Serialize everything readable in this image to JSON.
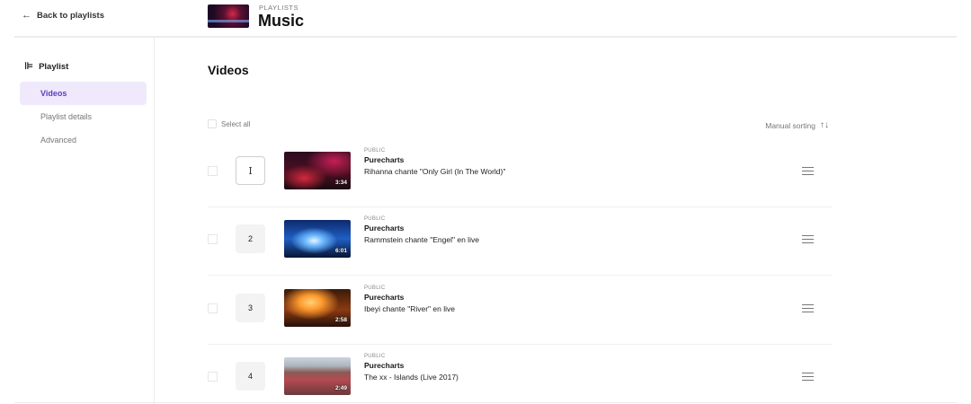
{
  "header": {
    "back_label": "Back to playlists",
    "kicker": "PLAYLISTS",
    "title": "Music"
  },
  "sidebar": {
    "heading": "Playlist",
    "items": [
      {
        "label": "Videos",
        "active": true
      },
      {
        "label": "Playlist details",
        "active": false
      },
      {
        "label": "Advanced",
        "active": false
      }
    ]
  },
  "main": {
    "section_title": "Videos",
    "select_all_label": "Select all",
    "sorting_label": "Manual sorting",
    "videos": [
      {
        "order": "",
        "visibility": "PUBLIC",
        "channel": "Purecharts",
        "title": "Rihanna chante \"Only Girl (In The World)\"",
        "duration": "3:34"
      },
      {
        "order": "2",
        "visibility": "PUBLIC",
        "channel": "Purecharts",
        "title": "Rammstein chante \"Engel\" en live",
        "duration": "6:01"
      },
      {
        "order": "3",
        "visibility": "PUBLIC",
        "channel": "Purecharts",
        "title": "Ibeyi chante \"River\" en live",
        "duration": "2:58"
      },
      {
        "order": "4",
        "visibility": "PUBLIC",
        "channel": "Purecharts",
        "title": "The xx - Islands (Live 2017)",
        "duration": "2:49"
      }
    ]
  },
  "icons": {
    "back": "arrow-left-icon",
    "playlist": "tree-icon",
    "sort": "sort-arrows-icon",
    "drag": "drag-handle-icon",
    "cursor": "text-cursor-icon"
  }
}
